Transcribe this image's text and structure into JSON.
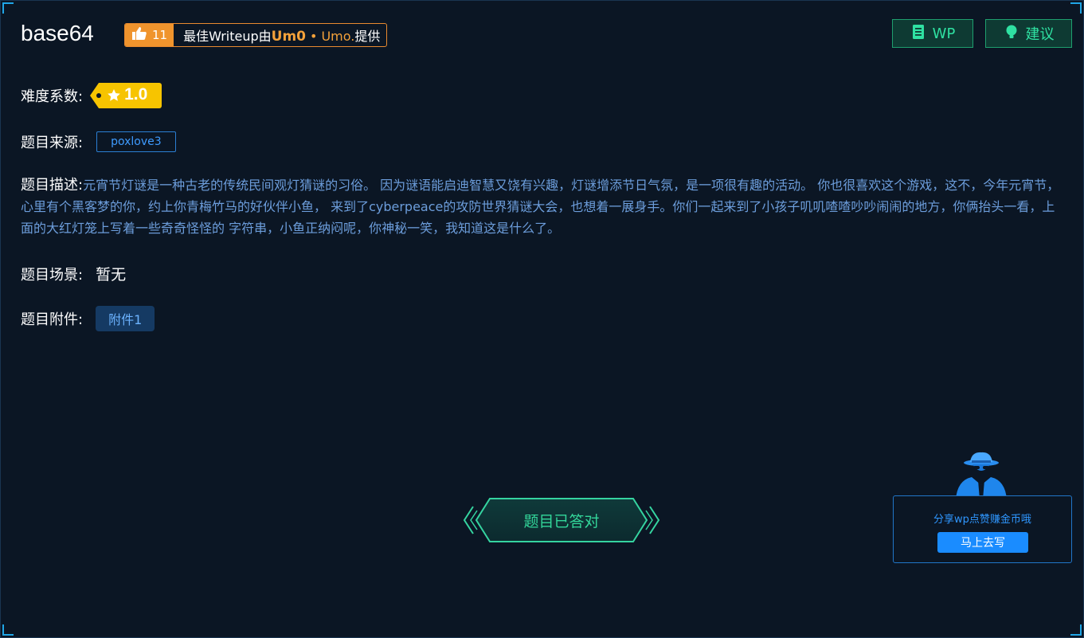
{
  "challenge": {
    "title": "base64",
    "like_count": "11",
    "writeup_prefix": "最佳Writeup由",
    "writeup_author": "Um0",
    "writeup_author2": "Umo.",
    "writeup_suffix": "提供"
  },
  "actions": {
    "wp_label": "WP",
    "advice_label": "建议"
  },
  "fields": {
    "difficulty_label": "难度系数:",
    "difficulty_value": "1.0",
    "source_label": "题目来源:",
    "source_value": "poxlove3",
    "desc_label": "题目描述:",
    "desc_text": "元宵节灯谜是一种古老的传统民间观灯猜谜的习俗。 因为谜语能启迪智慧又饶有兴趣，灯谜增添节日气氛，是一项很有趣的活动。 你也很喜欢这个游戏，这不，今年元宵节，心里有个黑客梦的你，约上你青梅竹马的好伙伴小鱼， 来到了cyberpeace的攻防世界猜谜大会，也想着一展身手。你们一起来到了小孩子叽叽喳喳吵吵闹闹的地方，你俩抬头一看，上面的大红灯笼上写着一些奇奇怪怪的 字符串，小鱼正纳闷呢，你神秘一笑，我知道这是什么了。",
    "scene_label": "题目场景:",
    "scene_value": "暂无",
    "attach_label": "题目附件:",
    "attach_value": "附件1"
  },
  "status": {
    "solved_label": "题目已答对"
  },
  "share": {
    "text": "分享wp点赞赚金币哦",
    "button_label": "马上去写"
  },
  "icons": {
    "like": "thumbs-up-icon",
    "wp": "document-icon",
    "advice": "lightbulb-icon",
    "difficulty": "star-icon",
    "share": "hacker-avatar-icon"
  },
  "colors": {
    "background": "#0b1624",
    "accent_green": "#2fe1a2",
    "accent_orange": "#f0942d",
    "accent_blue": "#1a8cff",
    "difficulty_yellow": "#f7c400"
  }
}
